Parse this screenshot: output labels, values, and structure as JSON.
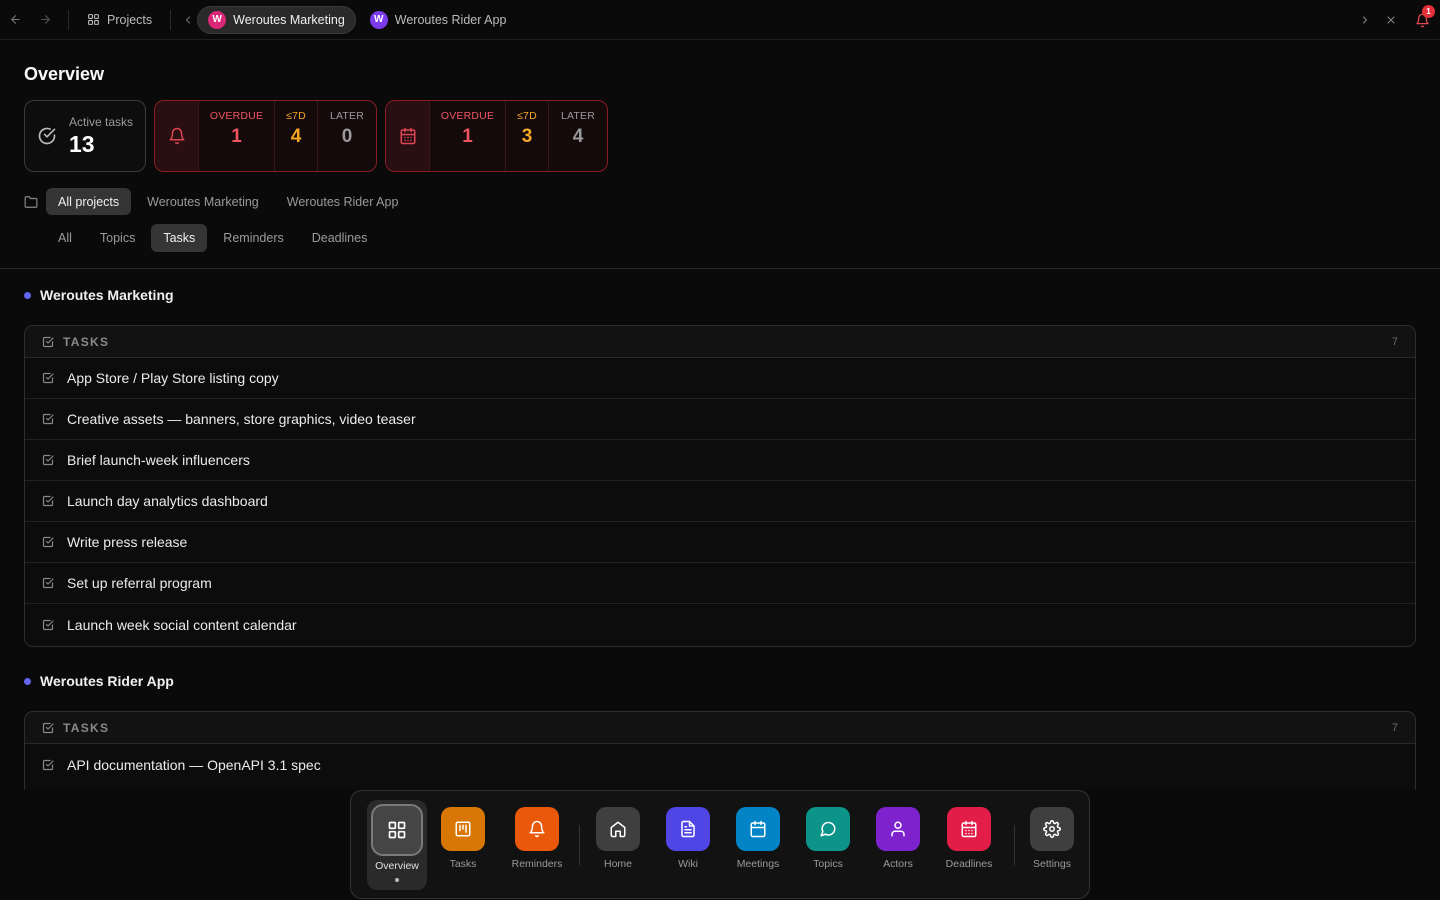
{
  "topbar": {
    "projects_label": "Projects",
    "tabs": [
      {
        "label": "Weroutes Marketing",
        "avatar": "W",
        "color": "#db2777",
        "active": true
      },
      {
        "label": "Weroutes Rider App",
        "avatar": "W",
        "color": "#7c3aed",
        "active": false
      }
    ],
    "notification_count": "1"
  },
  "page": {
    "title": "Overview"
  },
  "stats": {
    "active_label": "Active tasks",
    "active_value": "13",
    "reminders": [
      {
        "label": "OVERDUE",
        "value": "1",
        "color": "#f05461"
      },
      {
        "label": "≤7D",
        "value": "4",
        "color": "#f5a623"
      },
      {
        "label": "LATER",
        "value": "0",
        "color": "#9a9a9a"
      }
    ],
    "deadlines": [
      {
        "label": "OVERDUE",
        "value": "1",
        "color": "#f05461"
      },
      {
        "label": "≤7D",
        "value": "3",
        "color": "#f5a623"
      },
      {
        "label": "LATER",
        "value": "4",
        "color": "#9a9a9a"
      }
    ]
  },
  "project_filter": [
    "All projects",
    "Weroutes Marketing",
    "Weroutes Rider App"
  ],
  "type_filter": [
    "All",
    "Topics",
    "Tasks",
    "Reminders",
    "Deadlines"
  ],
  "groups": [
    {
      "title": "Weroutes Marketing",
      "section_label": "TASKS",
      "count": "7",
      "items": [
        "App Store / Play Store listing copy",
        "Creative assets — banners, store graphics, video teaser",
        "Brief launch-week influencers",
        "Launch day analytics dashboard",
        "Write press release",
        "Set up referral program",
        "Launch week social content calendar"
      ]
    },
    {
      "title": "Weroutes Rider App",
      "section_label": "TASKS",
      "count": "7",
      "items": [
        "API documentation — OpenAPI 3.1 spec"
      ]
    }
  ],
  "dock": [
    {
      "label": "Overview",
      "icon": "grid-icon",
      "color": "#454545"
    },
    {
      "label": "Tasks",
      "icon": "kanban-icon",
      "color": "#d97706"
    },
    {
      "label": "Reminders",
      "icon": "bell-icon",
      "color": "#ea580c"
    },
    {
      "label": "Home",
      "icon": "home-icon",
      "color": "#3f3f3f"
    },
    {
      "label": "Wiki",
      "icon": "document-icon",
      "color": "#4f46e5"
    },
    {
      "label": "Meetings",
      "icon": "calendar-icon",
      "color": "#0284c7"
    },
    {
      "label": "Topics",
      "icon": "chat-icon",
      "color": "#0d9488"
    },
    {
      "label": "Actors",
      "icon": "user-icon",
      "color": "#7e22ce"
    },
    {
      "label": "Deadlines",
      "icon": "calendar-grid-icon",
      "color": "#e11d48"
    },
    {
      "label": "Settings",
      "icon": "gear-icon",
      "color": "#3f3f3f"
    }
  ]
}
